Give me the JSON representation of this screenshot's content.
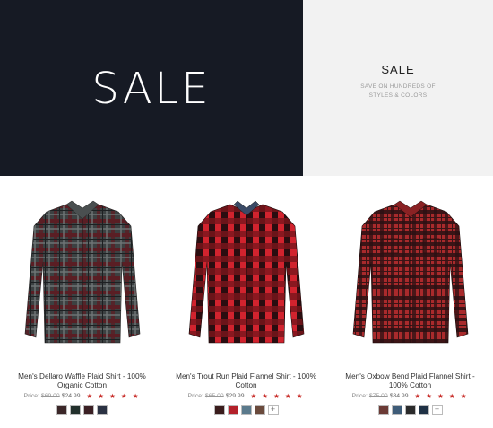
{
  "hero": {
    "big_label": "SALE",
    "title": "SALE",
    "subtitle_line1": "SAVE ON HUNDREDS OF",
    "subtitle_line2": "STYLES & COLORS"
  },
  "products": [
    {
      "name": "Men's Dellaro Waffle Plaid Shirt - 100% Organic Cotton",
      "price_label": "Price:",
      "old_price": "$69.00",
      "new_price": "$24.99",
      "stars": "★ ★ ★ ★ ★",
      "rating": 4.5,
      "image_icon": "shirt-gray-red-plaid",
      "swatch_colors": [
        "#3b2628",
        "#22302c",
        "#3a1f24",
        "#2a3142"
      ],
      "has_more_swatches": false
    },
    {
      "name": "Men's Trout Run Plaid Flannel Shirt - 100% Cotton",
      "price_label": "Price:",
      "old_price": "$65.00",
      "new_price": "$29.99",
      "stars": "★ ★ ★ ★ ★",
      "rating": 4.5,
      "image_icon": "shirt-red-black-buffalo-check",
      "swatch_colors": [
        "#3a1c1c",
        "#b3202a",
        "#5b7a8c",
        "#6a4a3c"
      ],
      "has_more_swatches": true,
      "more_label": "+"
    },
    {
      "name": "Men's Oxbow Bend Plaid Flannel Shirt - 100% Cotton",
      "price_label": "Price:",
      "old_price": "$75.00",
      "new_price": "$34.99",
      "stars": "★ ★ ★ ★ ★",
      "rating": 4.5,
      "image_icon": "shirt-red-black-plaid",
      "swatch_colors": [
        "#6b3a35",
        "#3e5c78",
        "#2b2b2b",
        "#1f3145"
      ],
      "has_more_swatches": true,
      "more_label": "+"
    }
  ],
  "colors": {
    "hero_dark": "#161a24",
    "hero_light": "#f2f2f2",
    "star_red": "#c9302c"
  }
}
